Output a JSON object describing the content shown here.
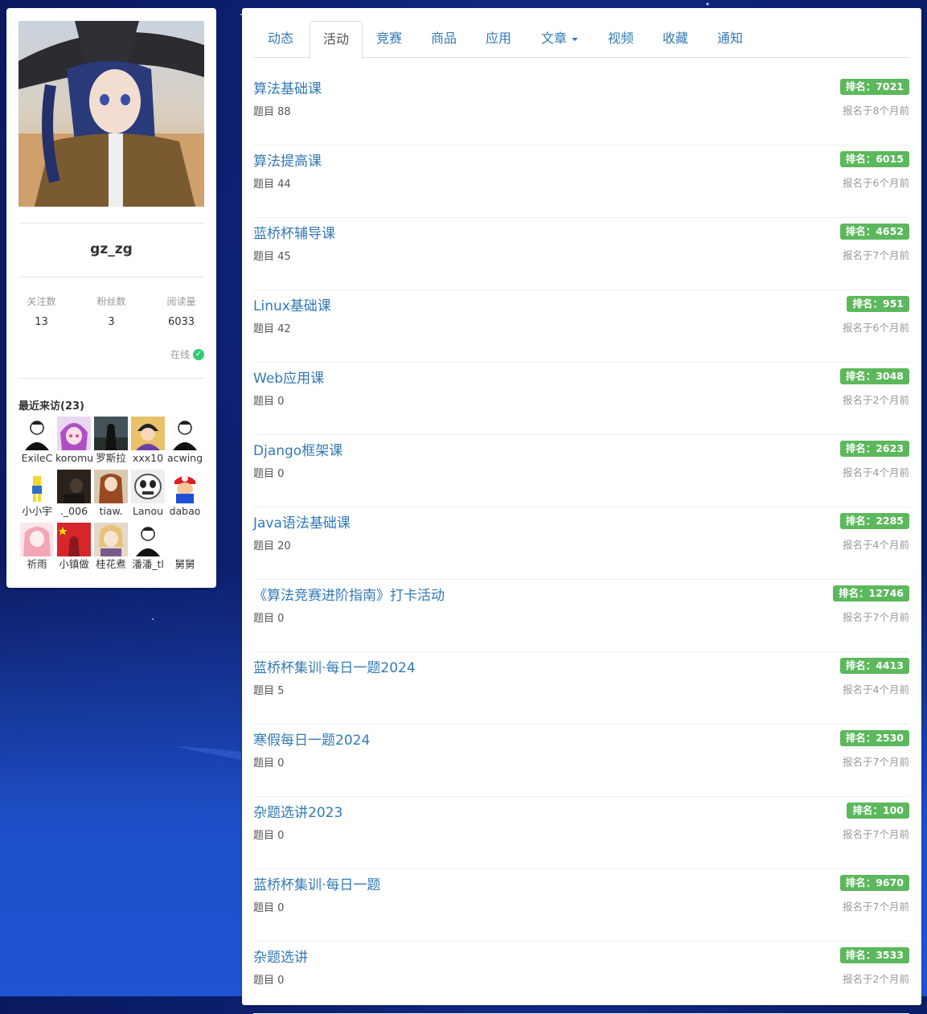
{
  "profile": {
    "username": "gz_zg",
    "stats": [
      {
        "label": "关注数",
        "value": "13"
      },
      {
        "label": "粉丝数",
        "value": "3"
      },
      {
        "label": "阅读量",
        "value": "6033"
      }
    ],
    "online_label": "在线",
    "visitors_title": "最近来访(23)",
    "visitors": [
      "ExileC",
      "koromu",
      "罗斯拉",
      "xxx10",
      "acwing",
      "小小宇",
      "._006",
      "tiaw.",
      "Lanou",
      "dabao",
      "祈雨",
      "小镇做",
      "桂花煮",
      "潘潘_tl",
      "舅舅"
    ]
  },
  "tabs": [
    {
      "label": "动态",
      "active": false
    },
    {
      "label": "活动",
      "active": true
    },
    {
      "label": "竞赛",
      "active": false
    },
    {
      "label": "商品",
      "active": false
    },
    {
      "label": "应用",
      "active": false
    },
    {
      "label": "文章",
      "active": false,
      "dropdown": true
    },
    {
      "label": "视频",
      "active": false
    },
    {
      "label": "收藏",
      "active": false
    },
    {
      "label": "通知",
      "active": false
    }
  ],
  "activities": [
    {
      "title": "算法基础课",
      "count": "题目 88",
      "rank": "排名：7021",
      "when": "报名于8个月前"
    },
    {
      "title": "算法提高课",
      "count": "题目 44",
      "rank": "排名：6015",
      "when": "报名于6个月前"
    },
    {
      "title": "蓝桥杯辅导课",
      "count": "题目 45",
      "rank": "排名：4652",
      "when": "报名于7个月前"
    },
    {
      "title": "Linux基础课",
      "count": "题目 42",
      "rank": "排名：951",
      "when": "报名于6个月前"
    },
    {
      "title": "Web应用课",
      "count": "题目 0",
      "rank": "排名：3048",
      "when": "报名于2个月前"
    },
    {
      "title": "Django框架课",
      "count": "题目 0",
      "rank": "排名：2623",
      "when": "报名于4个月前"
    },
    {
      "title": "Java语法基础课",
      "count": "题目 20",
      "rank": "排名：2285",
      "when": "报名于4个月前"
    },
    {
      "title": "《算法竞赛进阶指南》打卡活动",
      "count": "题目 0",
      "rank": "排名：12746",
      "when": "报名于7个月前"
    },
    {
      "title": "蓝桥杯集训·每日一题2024",
      "count": "题目 5",
      "rank": "排名：4413",
      "when": "报名于4个月前"
    },
    {
      "title": "寒假每日一题2024",
      "count": "题目 0",
      "rank": "排名：2530",
      "when": "报名于7个月前"
    },
    {
      "title": "杂题选讲2023",
      "count": "题目 0",
      "rank": "排名：100",
      "when": "报名于7个月前"
    },
    {
      "title": "蓝桥杯集训·每日一题",
      "count": "题目 0",
      "rank": "排名：9670",
      "when": "报名于7个月前"
    },
    {
      "title": "杂题选讲",
      "count": "题目 0",
      "rank": "排名：3533",
      "when": "报名于2个月前"
    }
  ],
  "colors": {
    "link": "#337ab7",
    "badge": "#5cb85c",
    "online": "#2ecc71",
    "background": "#1a3aa8"
  }
}
